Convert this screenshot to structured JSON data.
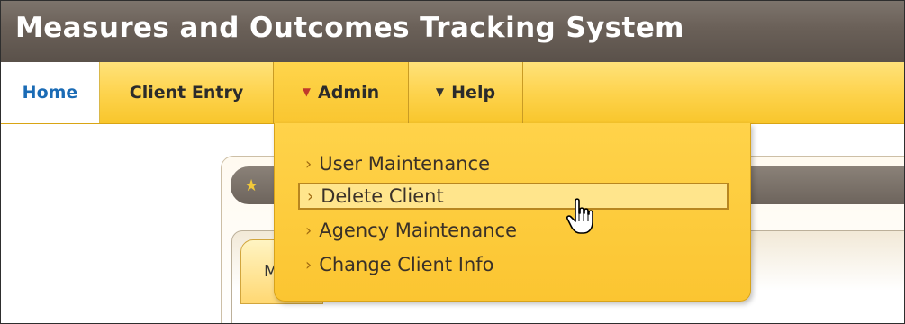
{
  "app": {
    "title": "Measures and Outcomes Tracking System"
  },
  "nav": {
    "items": [
      {
        "label": "Home"
      },
      {
        "label": "Client Entry"
      },
      {
        "label": "Admin",
        "icon": "dropdown-arrow-icon"
      },
      {
        "label": "Help",
        "icon": "dropdown-arrow-icon"
      }
    ],
    "active": "Admin"
  },
  "admin_menu": {
    "items": [
      {
        "label": "User Maintenance"
      },
      {
        "label": "Delete Client",
        "highlighted": true
      },
      {
        "label": "Agency Maintenance"
      },
      {
        "label": "Change Client Info"
      }
    ]
  },
  "background_panel": {
    "tab_label_fragment": "M"
  },
  "colors": {
    "title_bar": "#6a6058",
    "nav_bar": "#fdd24a",
    "home_link": "#1a6bb5",
    "menu_bg": "#fbc531",
    "menu_highlight_border": "#b8861f"
  },
  "cursor": "pointer-hand-icon"
}
